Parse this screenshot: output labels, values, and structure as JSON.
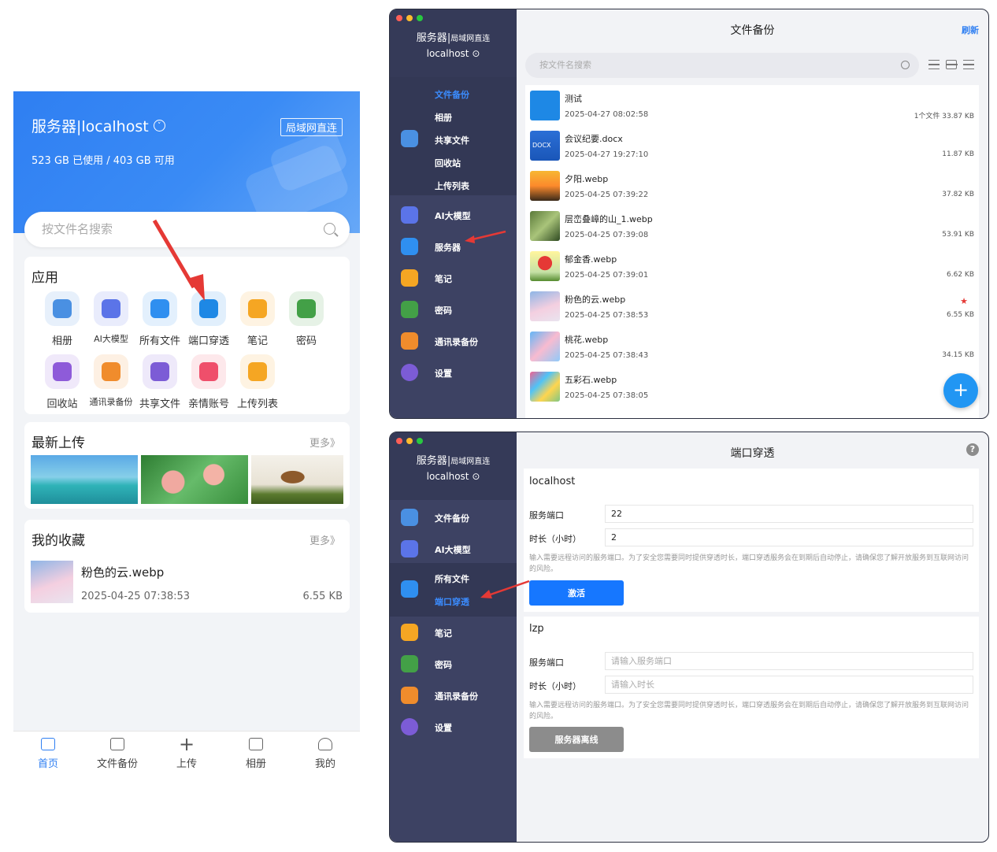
{
  "mobile": {
    "header": {
      "title": "服务器|localhost",
      "mode_tag": "局域网直连",
      "usage": "523 GB 已使用 / 403 GB 可用"
    },
    "search": {
      "placeholder": "按文件名搜索"
    },
    "apps": {
      "heading": "应用",
      "items": [
        {
          "label": "相册",
          "icon": "photo-icon",
          "color": "#4a90e2"
        },
        {
          "label": "AI大模型",
          "icon": "ai-icon",
          "color": "#5b74e8"
        },
        {
          "label": "所有文件",
          "icon": "folder-icon",
          "color": "#2f8ff0"
        },
        {
          "label": "端口穿透",
          "icon": "globe-icon",
          "color": "#1e88e5"
        },
        {
          "label": "笔记",
          "icon": "note-icon",
          "color": "#f5a623"
        },
        {
          "label": "密码",
          "icon": "lock-icon",
          "color": "#43a047"
        },
        {
          "label": "回收站",
          "icon": "trash-icon",
          "color": "#8e5bd9"
        },
        {
          "label": "通讯录备份",
          "icon": "contacts-icon",
          "color": "#f08c2c"
        },
        {
          "label": "共享文件",
          "icon": "share-icon",
          "color": "#7c5cd6"
        },
        {
          "label": "亲情账号",
          "icon": "family-icon",
          "color": "#ef4f6b"
        },
        {
          "label": "上传列表",
          "icon": "upload-list-icon",
          "color": "#f5a623"
        }
      ]
    },
    "recent": {
      "heading": "最新上传",
      "more": "更多》"
    },
    "favorites": {
      "heading": "我的收藏",
      "more": "更多》",
      "item": {
        "name": "粉色的云.webp",
        "date": "2025-04-25 07:38:53",
        "size": "6.55 KB"
      }
    },
    "tabs": [
      "首页",
      "文件备份",
      "上传",
      "相册",
      "我的"
    ]
  },
  "desktop1": {
    "sidebar": {
      "title": "服务器",
      "subtitle": "局域网直连",
      "host": "localhost",
      "group_items": [
        "文件备份",
        "相册",
        "共享文件",
        "回收站",
        "上传列表"
      ],
      "items": [
        "AI大模型",
        "服务器",
        "笔记",
        "密码",
        "通讯录备份",
        "设置"
      ]
    },
    "title": "文件备份",
    "refresh": "刷新",
    "search_placeholder": "按文件名搜索",
    "files": [
      {
        "name": "测试",
        "date": "2025-04-27 08:02:58",
        "size": "1个文件 33.87 KB",
        "thumb": "folder",
        "starred": false
      },
      {
        "name": "会议纪要.docx",
        "date": "2025-04-27 19:27:10",
        "size": "11.87 KB",
        "thumb": "docx",
        "starred": false
      },
      {
        "name": "夕阳.webp",
        "date": "2025-04-25 07:39:22",
        "size": "37.82 KB",
        "thumb": "sunset",
        "starred": false
      },
      {
        "name": "层峦叠嶂的山_1.webp",
        "date": "2025-04-25 07:39:08",
        "size": "53.91 KB",
        "thumb": "mountain",
        "starred": false
      },
      {
        "name": "郁金香.webp",
        "date": "2025-04-25 07:39:01",
        "size": "6.62 KB",
        "thumb": "tulip",
        "starred": false
      },
      {
        "name": "粉色的云.webp",
        "date": "2025-04-25 07:38:53",
        "size": "6.55 KB",
        "thumb": "cloud",
        "starred": true
      },
      {
        "name": "桃花.webp",
        "date": "2025-04-25 07:38:43",
        "size": "34.15 KB",
        "thumb": "peach",
        "starred": false
      },
      {
        "name": "五彩石.webp",
        "date": "2025-04-25 07:38:05",
        "size": "",
        "thumb": "stones",
        "starred": false
      }
    ],
    "doc_badge": "DOCX",
    "fab": "+"
  },
  "desktop2": {
    "sidebar": {
      "title": "服务器",
      "subtitle": "局域网直连",
      "host": "localhost",
      "items_top": [
        "文件备份",
        "AI大模型"
      ],
      "group_items": [
        "所有文件",
        "端口穿透"
      ],
      "items_bottom": [
        "笔记",
        "密码",
        "通讯录备份",
        "设置"
      ]
    },
    "title": "端口穿透",
    "help": "?",
    "panels": [
      {
        "host": "localhost",
        "port_label": "服务端口",
        "port_value": "22",
        "port_placeholder": "",
        "duration_label": "时长（小时）",
        "duration_value": "2",
        "duration_placeholder": "",
        "hint": "输入需要远程访问的服务端口。为了安全您需要同时提供穿透时长，端口穿透服务会在到期后自动停止，请确保您了解开放服务到互联网访问的风险。",
        "button": "激活"
      },
      {
        "host": "lzp",
        "port_label": "服务端口",
        "port_value": "",
        "port_placeholder": "请输入服务端口",
        "duration_label": "时长（小时）",
        "duration_value": "",
        "duration_placeholder": "请输入时长",
        "hint": "输入需要远程访问的服务端口。为了安全您需要同时提供穿透时长，端口穿透服务会在到期后自动停止，请确保您了解开放服务到互联网访问的风险。",
        "button": "服务器离线"
      }
    ]
  },
  "colors": {
    "accent": "#2f7ff2",
    "sidebar": "#3d4263",
    "annotation_arrow": "#e53935",
    "offline_button": "#8c8c8c"
  }
}
